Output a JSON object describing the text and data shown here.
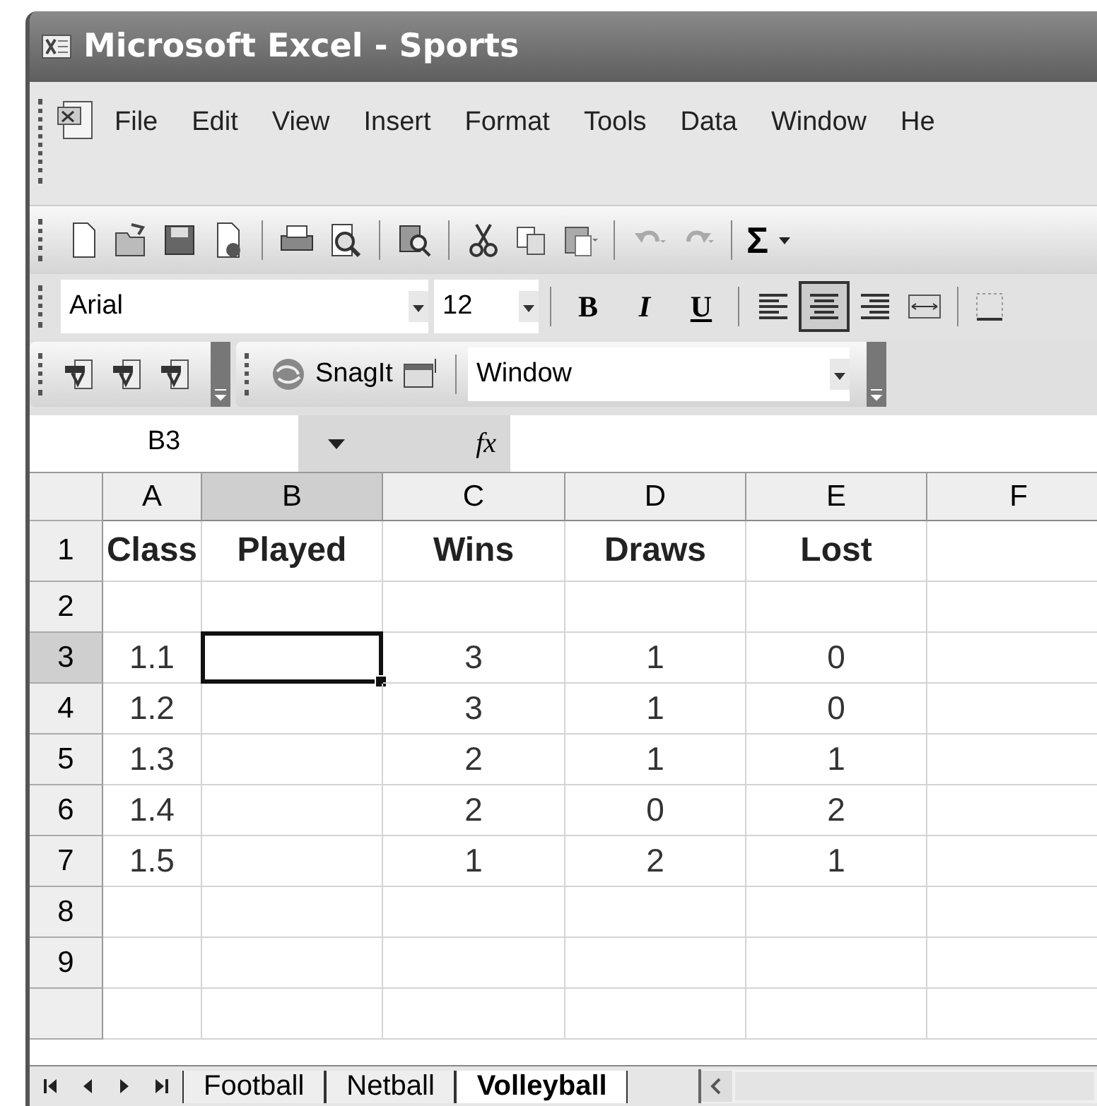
{
  "window": {
    "title": "Microsoft Excel - Sports"
  },
  "menu": [
    "File",
    "Edit",
    "View",
    "Insert",
    "Format",
    "Tools",
    "Data",
    "Window",
    "He"
  ],
  "standard_toolbar": {
    "sum_symbol": "Σ"
  },
  "formatting_toolbar": {
    "font": "Arial",
    "size": "12",
    "bold": "B",
    "italic": "I",
    "underline": "U",
    "align_center_selected": true
  },
  "extra_toolbar": {
    "snagit": "SnagIt",
    "dropdown": "Window"
  },
  "formula_bar": {
    "name_box": "B3",
    "fx": "fx"
  },
  "columns": [
    {
      "label": "A",
      "selected": false
    },
    {
      "label": "B",
      "selected": true
    },
    {
      "label": "C",
      "selected": false
    },
    {
      "label": "D",
      "selected": false
    },
    {
      "label": "E",
      "selected": false
    },
    {
      "label": "F",
      "selected": false
    }
  ],
  "rows": [
    {
      "label": "1",
      "selected": false,
      "header": true,
      "cells": {
        "A": "Class",
        "B": "Played",
        "C": "Wins",
        "D": "Draws",
        "E": "Lost"
      }
    },
    {
      "label": "2",
      "selected": false
    },
    {
      "label": "3",
      "selected": true,
      "cells": {
        "A": "1.1",
        "C": "3",
        "D": "1",
        "E": "0"
      }
    },
    {
      "label": "4",
      "selected": false,
      "cells": {
        "A": "1.2",
        "C": "3",
        "D": "1",
        "E": "0"
      }
    },
    {
      "label": "5",
      "selected": false,
      "cells": {
        "A": "1.3",
        "C": "2",
        "D": "1",
        "E": "1"
      }
    },
    {
      "label": "6",
      "selected": false,
      "cells": {
        "A": "1.4",
        "C": "2",
        "D": "0",
        "E": "2"
      }
    },
    {
      "label": "7",
      "selected": false,
      "cells": {
        "A": "1.5",
        "C": "1",
        "D": "2",
        "E": "1"
      }
    },
    {
      "label": "8",
      "selected": false
    },
    {
      "label": "9",
      "selected": false
    }
  ],
  "sheet_tabs": [
    {
      "label": "Football",
      "selected": false
    },
    {
      "label": "Netball",
      "selected": false
    },
    {
      "label": "Volleyball",
      "selected": true
    }
  ]
}
